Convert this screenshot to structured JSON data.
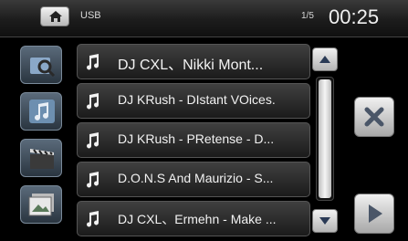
{
  "header": {
    "source": "USB",
    "page": "1/5",
    "time": "00:25"
  },
  "tracks": [
    "DJ CXL、Nikki Mont...",
    "DJ KRush - DIstant VOices.",
    "DJ KRush - PRetense - D...",
    "D.O.N.S And Maurizio - S...",
    "DJ CXL、Ermehn - Make ..."
  ],
  "icons": {
    "home": "home-icon",
    "search": "search-folder-icon",
    "music": "music-icon",
    "video": "clapperboard-icon",
    "photo": "photo-icon",
    "close": "close-icon",
    "play": "play-icon"
  }
}
